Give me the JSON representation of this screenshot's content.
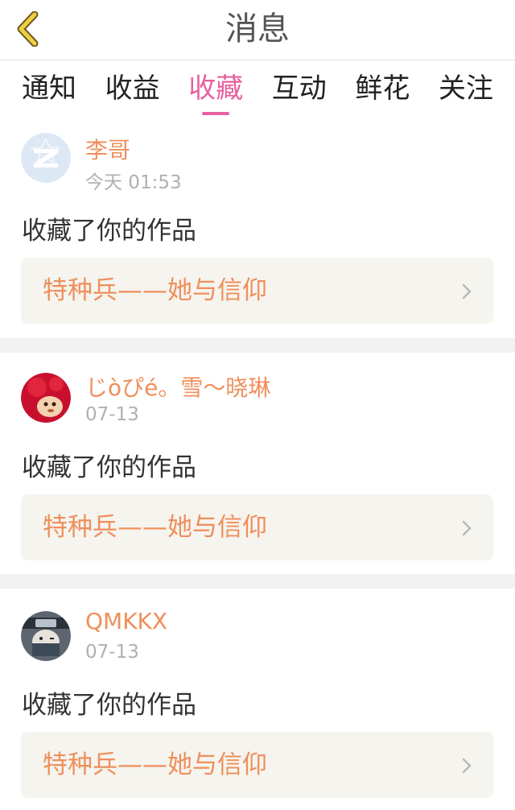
{
  "header": {
    "title": "消息",
    "back_icon": "chevron-left-icon",
    "back_color": "#e6c23a"
  },
  "tabs": [
    {
      "label": "通知",
      "active": false
    },
    {
      "label": "收益",
      "active": false
    },
    {
      "label": "收藏",
      "active": true
    },
    {
      "label": "互动",
      "active": false
    },
    {
      "label": "鲜花",
      "active": false
    },
    {
      "label": "关注",
      "active": false
    }
  ],
  "accent_color": "#e8609e",
  "name_color": "#ef8f5c",
  "items": [
    {
      "user": "李哥",
      "time": "今天 01:53",
      "action": "收藏了你的作品",
      "work": "特种兵——她与信仰",
      "avatar": "qq-default-avatar-icon"
    },
    {
      "user": "じòぴé。雪～晓琳",
      "time": "07-13",
      "action": "收藏了你的作品",
      "work": "特种兵——她与信仰",
      "avatar": "red-monkey-avatar-icon"
    },
    {
      "user": "QMKKX",
      "time": "07-13",
      "action": "收藏了你的作品",
      "work": "特种兵——她与信仰",
      "avatar": "ninja-avatar-icon"
    }
  ]
}
